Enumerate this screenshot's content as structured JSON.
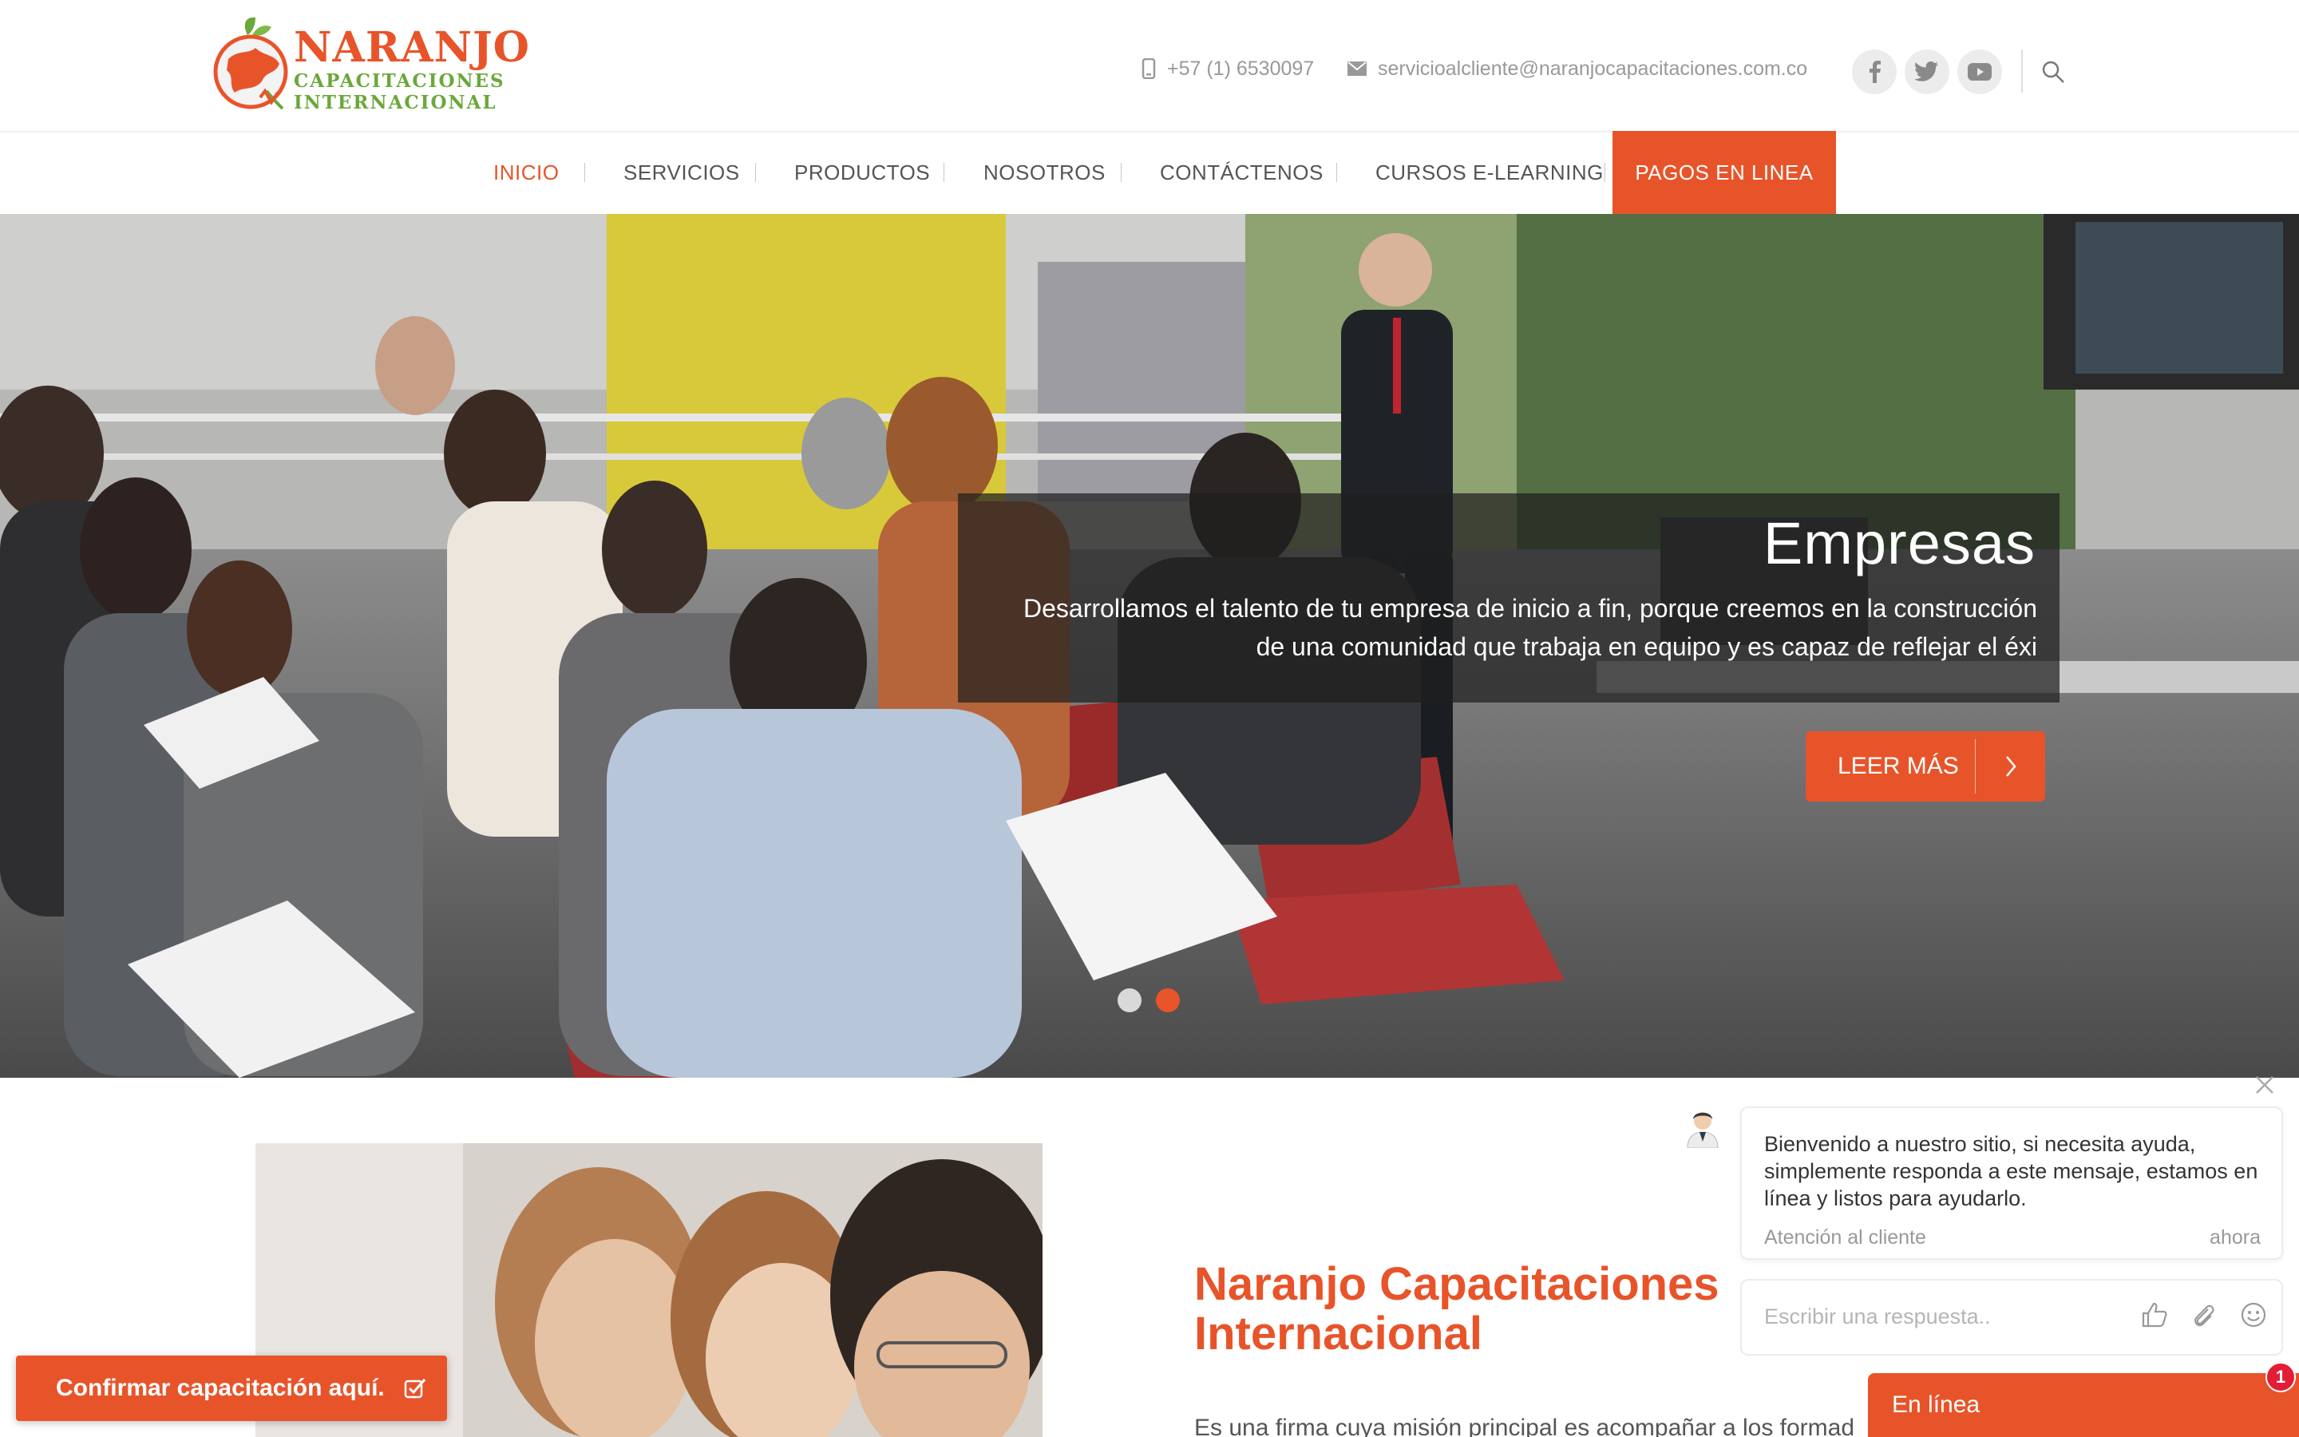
{
  "brand": {
    "name": "NARANJO",
    "line2": "CAPACITACIONES",
    "line3": "INTERNACIONAL"
  },
  "header": {
    "phone": "+57 (1) 6530097",
    "email": "servicioalcliente@naranjocapacitaciones.com.co",
    "socials": [
      "facebook-icon",
      "twitter-icon",
      "youtube-icon"
    ]
  },
  "nav": {
    "items": [
      {
        "label": "INICIO",
        "active": true
      },
      {
        "label": "SERVICIOS"
      },
      {
        "label": "PRODUCTOS"
      },
      {
        "label": "NOSOTROS"
      },
      {
        "label": "CONTÁCTENOS"
      },
      {
        "label": "CURSOS E-LEARNING"
      }
    ],
    "cta": "PAGOS EN LINEA"
  },
  "hero": {
    "title": "Empresas",
    "text": "Desarrollamos el talento de tu empresa de inicio a fin, porque creemos en la construcción de una comunidad que trabaja en equipo y es capaz de reflejar el éxi",
    "button": "LEER MÁS",
    "slides": 2,
    "active_slide": 2
  },
  "about": {
    "title_line1": "Naranjo Capacitaciones",
    "title_line2": "Internacional",
    "text": "Es una firma cuya misión principal es acompañar a los formad"
  },
  "confirm": {
    "label": "Confirmar capacitación aquí."
  },
  "chat": {
    "message": "Bienvenido a nuestro sitio, si necesita ayuda, simplemente responda a este mensaje, estamos en línea y listos para ayudarlo.",
    "from": "Atención al cliente",
    "time": "ahora",
    "placeholder": "Escribir una respuesta..",
    "status": "En línea",
    "badge": "1"
  },
  "colors": {
    "accent": "#e8542a",
    "green": "#6aa83a",
    "badge": "#e31d36"
  }
}
